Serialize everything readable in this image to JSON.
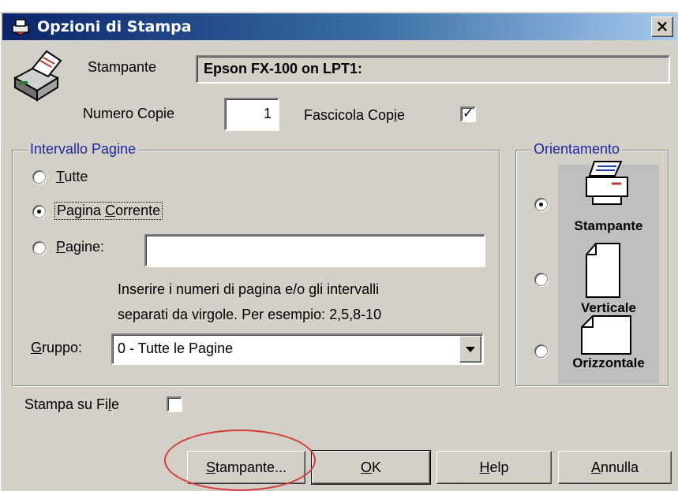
{
  "dialog": {
    "title": "Opzioni di Stampa",
    "close_label": "×"
  },
  "printer": {
    "label": "Stampante",
    "value": "Epson FX-100 on LPT1:"
  },
  "copies": {
    "label": "Numero Copie",
    "value": "1",
    "collate_label_pre": "Fascicola Cop",
    "collate_label_u": "i",
    "collate_label_post": "e",
    "collate_checked": true
  },
  "page_range": {
    "title": "Intervallo Pagine",
    "options": [
      {
        "u": "T",
        "rest": "utte",
        "checked": false
      },
      {
        "pre": "Pagina ",
        "u": "C",
        "rest": "orrente",
        "checked": true
      },
      {
        "u": "P",
        "rest": "agine:",
        "checked": false
      }
    ],
    "pages_input": "",
    "hint_line1": "Inserire i numeri di pagina e/o gli intervalli",
    "hint_line2": "separati da virgole. Per esempio: 2,5,8-10",
    "group_label_u": "G",
    "group_label_rest": "ruppo:",
    "group_value": "0 - Tutte le Pagine"
  },
  "orientation": {
    "title": "Orientamento",
    "options": [
      {
        "label": "Stampante",
        "checked": true
      },
      {
        "label": "Verticale",
        "checked": false
      },
      {
        "label": "Orizzontale",
        "checked": false
      }
    ]
  },
  "print_to_file": {
    "label_pre": "Stampa su Fi",
    "label_u": "l",
    "label_post": "e",
    "checked": false
  },
  "buttons": {
    "printer_u": "S",
    "printer_rest": "tampante...",
    "ok_u": "O",
    "ok_rest": "K",
    "help_u": "H",
    "help_rest": "elp",
    "cancel_u": "A",
    "cancel_rest": "nnulla"
  },
  "colors": {
    "title_gradient_start": "#0a246a",
    "title_gradient_end": "#a6caf0",
    "groupbox_title": "#1b2aa0",
    "annotation_ellipse": "#d23c3c"
  }
}
